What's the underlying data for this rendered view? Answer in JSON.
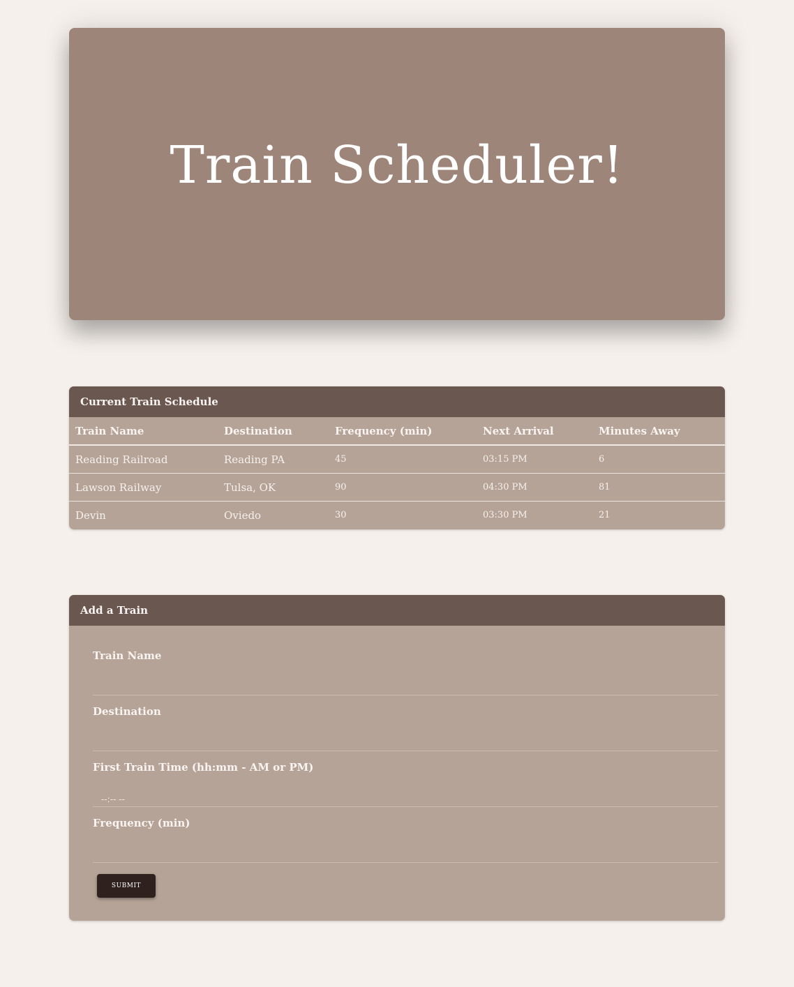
{
  "hero": {
    "title": "Train Scheduler!"
  },
  "schedule": {
    "header": "Current Train Schedule",
    "columns": [
      "Train Name",
      "Destination",
      "Frequency (min)",
      "Next Arrival",
      "Minutes Away"
    ],
    "rows": [
      [
        "Reading Railroad",
        "Reading PA",
        "45",
        "03:15 PM",
        "6"
      ],
      [
        "Lawson Railway",
        "Tulsa, OK",
        "90",
        "04:30 PM",
        "81"
      ],
      [
        "Devin",
        "Oviedo",
        "30",
        "03:30 PM",
        "21"
      ]
    ]
  },
  "add_train": {
    "header": "Add a Train",
    "fields": {
      "train_name_label": "Train Name",
      "destination_label": "Destination",
      "first_time_label": "First Train Time (hh:mm - AM or PM)",
      "first_time_placeholder": "--:-- --",
      "frequency_label": "Frequency (min)"
    },
    "submit_label": "SUBMIT"
  },
  "colors": {
    "page_bg": "#f5f0ec",
    "hero_bg": "#9e857a",
    "card_header": "#6a5850",
    "card_body": "#b5a397",
    "button": "#2f221e"
  }
}
